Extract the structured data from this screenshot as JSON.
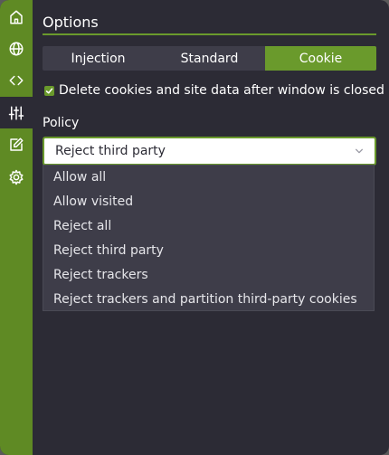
{
  "sidebar": {
    "items": [
      {
        "name": "home",
        "icon": "home-icon"
      },
      {
        "name": "globe",
        "icon": "globe-icon"
      },
      {
        "name": "code",
        "icon": "code-icon"
      },
      {
        "name": "sliders",
        "icon": "sliders-icon",
        "active": true
      },
      {
        "name": "edit",
        "icon": "edit-icon"
      },
      {
        "name": "settings",
        "icon": "gear-icon"
      }
    ]
  },
  "header": {
    "title": "Options"
  },
  "tabs": [
    {
      "label": "Injection",
      "active": false
    },
    {
      "label": "Standard",
      "active": false
    },
    {
      "label": "Cookie",
      "active": true
    }
  ],
  "cookie": {
    "delete_on_close": {
      "label": "Delete cookies and site data after window is closed",
      "checked": true
    },
    "policy": {
      "label": "Policy",
      "selected": "Reject third party",
      "options": [
        "Allow all",
        "Allow visited",
        "Reject all",
        "Reject third party",
        "Reject trackers",
        "Reject trackers and partition third-party cookies"
      ]
    }
  },
  "colors": {
    "accent": "#6a9a2c",
    "sidebar": "#5f8a24",
    "background": "#2c2b35",
    "panel": "#3e3d49"
  }
}
